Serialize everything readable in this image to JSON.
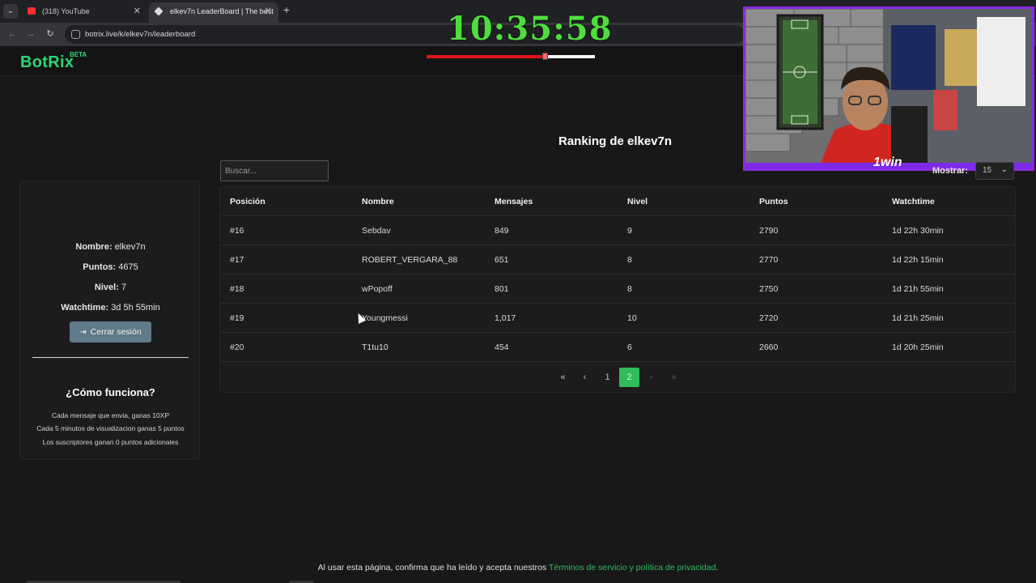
{
  "browser": {
    "tabs": [
      {
        "title": "(318) YouTube",
        "active": false
      },
      {
        "title": "elkev7n LeaderBoard | The best",
        "active": true
      }
    ],
    "url": "botrix.live/k/elkev7n/leaderboard",
    "new_tab_label": "+",
    "close_glyph": "✕"
  },
  "header": {
    "logo": "BotRix",
    "logo_badge": "BETA"
  },
  "overlay": {
    "clock": "10:35:58",
    "win_badge": "1win",
    "video_progress": 0.7,
    "accent_color": "#8a2be2"
  },
  "main": {
    "title": "Ranking de elkev7n",
    "search_placeholder": "Buscar...",
    "show_label": "Mostrar:",
    "show_value": "15",
    "columns": [
      "Posición",
      "Nombre",
      "Mensajes",
      "Nivel",
      "Puntos",
      "Watchtime"
    ],
    "rows": [
      [
        "#16",
        "Sebdav",
        "849",
        "9",
        "2790",
        "1d 22h 30min"
      ],
      [
        "#17",
        "ROBERT_VERGARA_88",
        "651",
        "8",
        "2770",
        "1d 22h 15min"
      ],
      [
        "#18",
        "wPopoff",
        "801",
        "8",
        "2750",
        "1d 21h 55min"
      ],
      [
        "#19",
        "Youngmessi",
        "1,017",
        "10",
        "2720",
        "1d 21h 25min"
      ],
      [
        "#20",
        "T1tu10",
        "454",
        "6",
        "2660",
        "1d 20h 25min"
      ]
    ],
    "pagination": {
      "first": "«",
      "prev": "‹",
      "pages": [
        "1",
        "2"
      ],
      "current": "2",
      "next": "›",
      "last": "»"
    }
  },
  "sidebar": {
    "name_label": "Nombre:",
    "name_value": "elkev7n",
    "points_label": "Puntos:",
    "points_value": "4675",
    "level_label": "Nivel:",
    "level_value": "7",
    "watchtime_label": "Watchtime:",
    "watchtime_value": "3d 5h 55min",
    "logout_label": "Cerrar sesión",
    "how_title": "¿Cómo funciona?",
    "how_lines": [
      "Cada mensaje que envia, ganas 10XP",
      "Cada 5 minutos de visualizacion ganas 5 puntos",
      "Los suscriptores ganan 0 puntos adicionales"
    ]
  },
  "footer": {
    "text": "Al usar esta página, confirma que ha leído y acepta nuestros",
    "link": "Términos de servicio y política de privacidad",
    "suffix": "."
  },
  "colors": {
    "brand": "#2ed573",
    "active_page": "#2ebd59",
    "logout_button": "#5f7a88"
  }
}
